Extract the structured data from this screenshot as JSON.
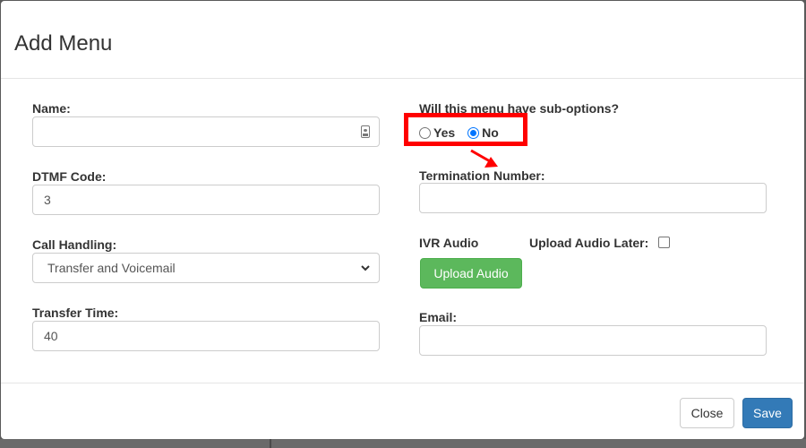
{
  "modal": {
    "title": "Add Menu"
  },
  "form": {
    "name": {
      "label": "Name:",
      "value": ""
    },
    "dtmf_code": {
      "label": "DTMF Code:",
      "value": "3"
    },
    "call_handling": {
      "label": "Call Handling:",
      "value": "Transfer and Voicemail"
    },
    "transfer_time": {
      "label": "Transfer Time:",
      "value": "40"
    },
    "sub_options": {
      "label": "Will this menu have sub-options?",
      "yes_label": "Yes",
      "no_label": "No",
      "selected": "No"
    },
    "termination_number": {
      "label": "Termination Number:",
      "value": ""
    },
    "ivr_audio": {
      "label": "IVR Audio",
      "upload_later_label": "Upload Audio Later:",
      "upload_later_checked": false,
      "upload_button_label": "Upload Audio"
    },
    "email": {
      "label": "Email:",
      "value": ""
    }
  },
  "footer": {
    "close_label": "Close",
    "save_label": "Save"
  },
  "colors": {
    "highlight": "#ff0000",
    "upload_button": "#5cb85c",
    "save_button": "#337ab7",
    "radio_accent": "#0075ff"
  },
  "icons": {
    "name_field_icon": "contact-card-icon",
    "select_caret": "chevron-down-icon",
    "annotation_arrow": "red-arrow-icon"
  }
}
